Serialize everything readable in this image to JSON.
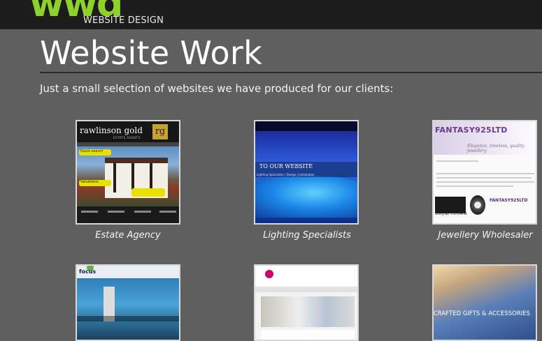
{
  "header": {
    "logo_mark": "wwd",
    "logo_sub": "WEBSITE DESIGN"
  },
  "page": {
    "title": "Website Work",
    "intro": "Just a small selection of websites we have produced for our clients:"
  },
  "portfolio": {
    "items": [
      {
        "caption": "Estate Agency",
        "thumb_brand": "rawlinson gold",
        "thumb_brand_sub": "ESTATE AGENTS",
        "thumb_logo": "rg",
        "thumb_tag_1": "Quick search",
        "thumb_tag_2": "Valuations"
      },
      {
        "caption": "Lighting Specialists",
        "thumb_welcome": "TO OUR WEBSITE",
        "thumb_sub": "Lighting Specialists | Design | Installation"
      },
      {
        "caption": "Jewellery Wholesaler",
        "thumb_brand": "FANTASY925LTD",
        "thumb_tag": "Elegance, timeless, quality jewellery",
        "thumb_brand_2": "FANTASY925LTD",
        "thumb_crown": "Royal Crown"
      },
      {
        "caption": "",
        "thumb_brand": "focus"
      },
      {
        "caption": ""
      },
      {
        "caption": "",
        "thumb_label": "CRAFTED GIFTS & ACCESSORIES"
      }
    ]
  },
  "colors": {
    "background": "#5f5f5f",
    "topbar": "#1c1c1c",
    "logo_green": "#8ed12a"
  }
}
